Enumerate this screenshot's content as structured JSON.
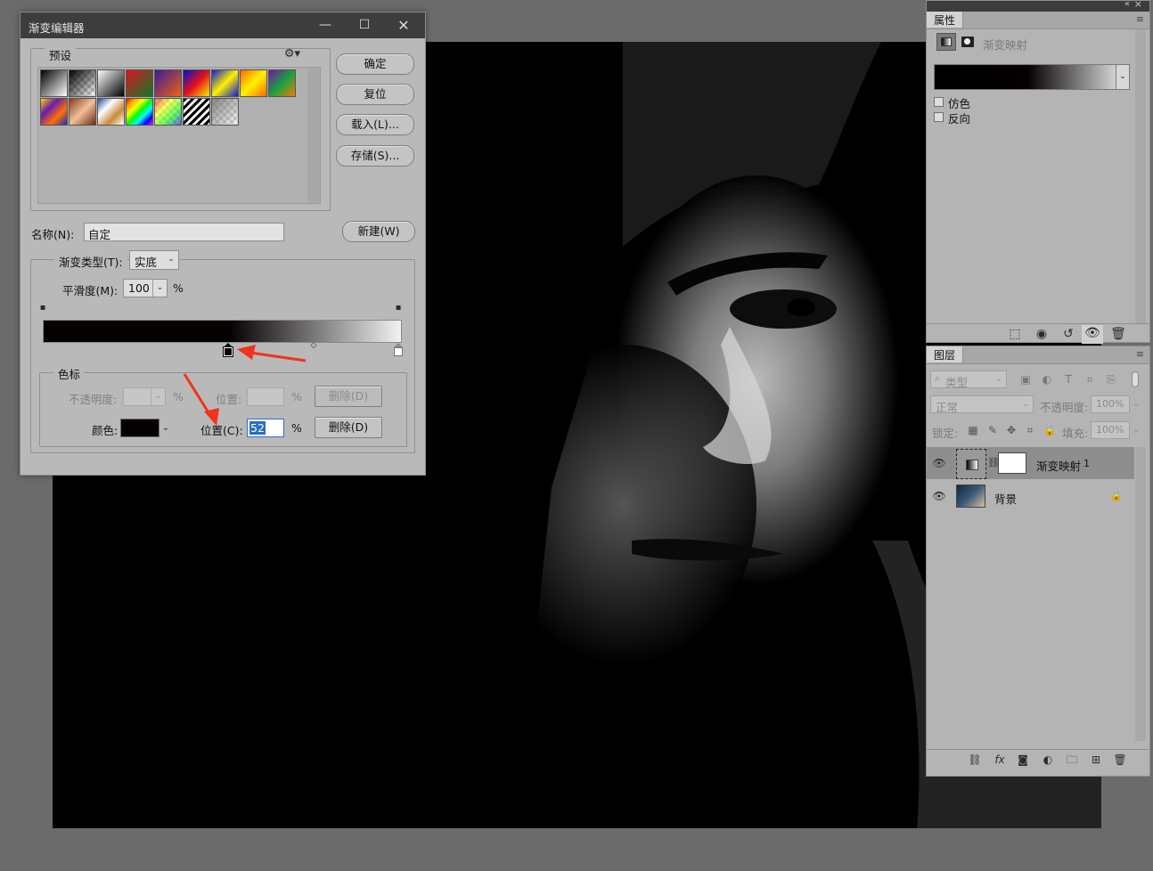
{
  "dialog": {
    "title": "渐变编辑器",
    "presets_label": "预设",
    "buttons": {
      "ok": "确定",
      "reset": "复位",
      "load": "载入(L)...",
      "save": "存储(S)...",
      "new": "新建(W)"
    },
    "name_label": "名称(N):",
    "name_value": "自定",
    "gradient_type_label": "渐变类型(T):",
    "gradient_type_value": "实底",
    "smoothness_label": "平滑度(M):",
    "smoothness_value": "100",
    "percent": "%",
    "stops_label": "色标",
    "opacity_label": "不透明度:",
    "location_label_disabled": "位置:",
    "delete_label": "删除(D)",
    "color_label": "颜色:",
    "location_label": "位置(C):",
    "location_value": "52",
    "color_swatch": "#050001"
  },
  "preset_swatches": [
    {
      "name": "black-white",
      "css": "linear-gradient(135deg,#000,#fff)"
    },
    {
      "name": "black-transparent",
      "css": "linear-gradient(135deg,#000,rgba(0,0,0,0))"
    },
    {
      "name": "white-black",
      "css": "linear-gradient(135deg,#fff,#000)"
    },
    {
      "name": "red-green",
      "css": "linear-gradient(135deg,#e0141e,#0a7a2c)"
    },
    {
      "name": "violet-orange",
      "css": "linear-gradient(135deg,#3a1a9a,#f06010)"
    },
    {
      "name": "blue-red-yellow",
      "css": "linear-gradient(135deg,#0010d0,#e0101c,#ffe800)"
    },
    {
      "name": "blue-yellow-blue",
      "css": "linear-gradient(135deg,#0a1ad6,#fff000,#0a1ad6)"
    },
    {
      "name": "orange-yellow-orange",
      "css": "linear-gradient(135deg,#ff6a00,#fff200,#ff6a00)"
    },
    {
      "name": "violet-green-orange",
      "css": "linear-gradient(135deg,#7a10a8,#18a040,#f08000)"
    },
    {
      "name": "yellow-violet-orange-blue",
      "css": "linear-gradient(135deg,#ffd800,#6a1ab0,#ff7000,#1030c0)"
    },
    {
      "name": "copper",
      "css": "linear-gradient(135deg,#8a3a1a,#f2c09a,#6a2a10)"
    },
    {
      "name": "chrome",
      "css": "linear-gradient(135deg,#1a4c9a,#fff,#c88a3a,#fff)"
    },
    {
      "name": "spectrum",
      "css": "linear-gradient(135deg,red,orange,yellow,lime,cyan,blue,magenta)"
    },
    {
      "name": "transparent-rainbow",
      "css": "linear-gradient(135deg,rgba(255,0,0,.6),rgba(255,255,0,.6),rgba(0,255,0,.6),rgba(0,0,255,.6))"
    },
    {
      "name": "transparent-stripes",
      "css": "repeating-linear-gradient(135deg,#000 0 3px,#fff 3px 6px)"
    },
    {
      "name": "neutral-density",
      "css": "linear-gradient(135deg,rgba(120,120,120,.9),rgba(200,200,200,.2))"
    }
  ],
  "properties_panel": {
    "tab": "属性",
    "title": "渐变映射",
    "dither_label": "仿色",
    "reverse_label": "反向"
  },
  "layers_panel": {
    "tab": "图层",
    "filter_kind": "类型",
    "blend_mode": "正常",
    "opacity_label": "不透明度:",
    "opacity_value": "100%",
    "lock_label": "锁定:",
    "fill_label": "填充:",
    "fill_value": "100%",
    "layers": [
      {
        "name": "渐变映射",
        "suffix": "1"
      },
      {
        "name": "背景"
      }
    ]
  }
}
